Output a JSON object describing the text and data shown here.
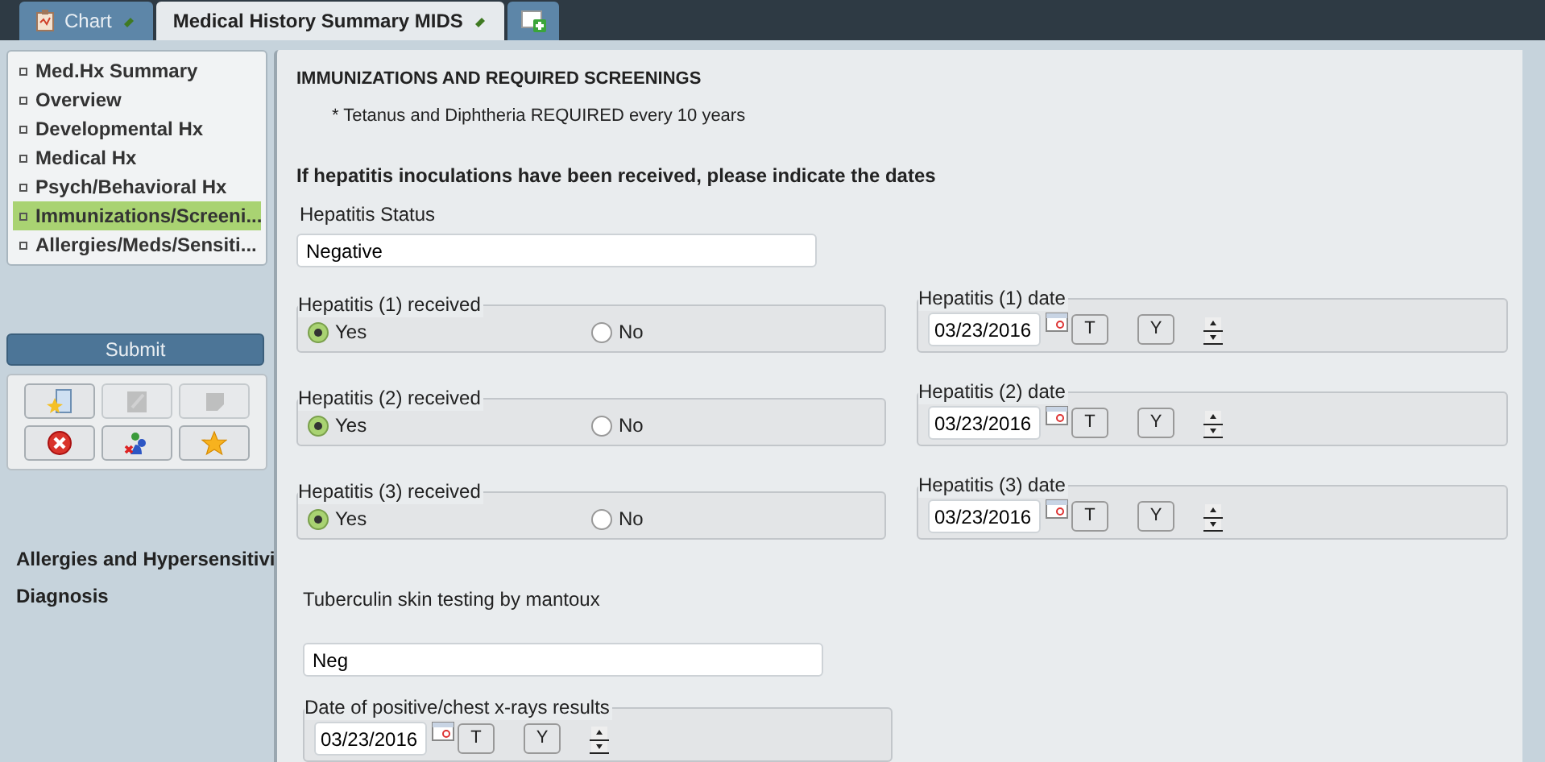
{
  "tabs": [
    {
      "kind": "chart",
      "label": "Chart",
      "selected": false
    },
    {
      "kind": "form",
      "label": "Medical History Summary MIDS",
      "selected": true
    }
  ],
  "sidebar": {
    "items": [
      {
        "label": "Med.Hx Summary",
        "selected": false
      },
      {
        "label": "Overview",
        "selected": false
      },
      {
        "label": "Developmental Hx",
        "selected": false
      },
      {
        "label": "Medical Hx",
        "selected": false
      },
      {
        "label": "Psych/Behavioral Hx",
        "selected": false
      },
      {
        "label": "Immunizations/Screeni...",
        "selected": true
      },
      {
        "label": "Allergies/Meds/Sensiti...",
        "selected": false
      }
    ],
    "submit": "Submit",
    "tools": [
      {
        "kind": "new",
        "disabled": false
      },
      {
        "kind": "edit",
        "disabled": true
      },
      {
        "kind": "note",
        "disabled": true
      },
      {
        "kind": "delete",
        "disabled": false
      },
      {
        "kind": "people",
        "disabled": false
      },
      {
        "kind": "star",
        "disabled": false
      }
    ],
    "sections": [
      "Allergies and Hypersensitivi",
      "Diagnosis"
    ]
  },
  "form": {
    "title": "IMMUNIZATIONS AND REQUIRED SCREENINGS",
    "note": "* Tetanus and Diphtheria REQUIRED every 10 years",
    "question": "If hepatitis inoculations have been received, please indicate the dates",
    "status": {
      "label": "Hepatitis Status",
      "value": "Negative"
    },
    "doses": [
      {
        "received_label": "Hepatitis (1) received",
        "options": [
          {
            "label": "Yes",
            "selected": true
          },
          {
            "label": "No",
            "selected": false
          }
        ],
        "date_label": "Hepatitis (1) date",
        "date": "03/23/2016",
        "today": "T",
        "yesterday": "Y"
      },
      {
        "received_label": "Hepatitis (2) received",
        "options": [
          {
            "label": "Yes",
            "selected": true
          },
          {
            "label": "No",
            "selected": false
          }
        ],
        "date_label": "Hepatitis (2) date",
        "date": "03/23/2016",
        "today": "T",
        "yesterday": "Y"
      },
      {
        "received_label": "Hepatitis (3) received",
        "options": [
          {
            "label": "Yes",
            "selected": true
          },
          {
            "label": "No",
            "selected": false
          }
        ],
        "date_label": "Hepatitis (3) date",
        "date": "03/23/2016",
        "today": "T",
        "yesterday": "Y"
      }
    ],
    "tb": {
      "label": "Tuberculin skin testing by mantoux",
      "value": "Neg"
    },
    "positive": {
      "label": "Date of positive/chest x-rays results",
      "date": "03/23/2016",
      "today": "T",
      "yesterday": "Y"
    }
  }
}
